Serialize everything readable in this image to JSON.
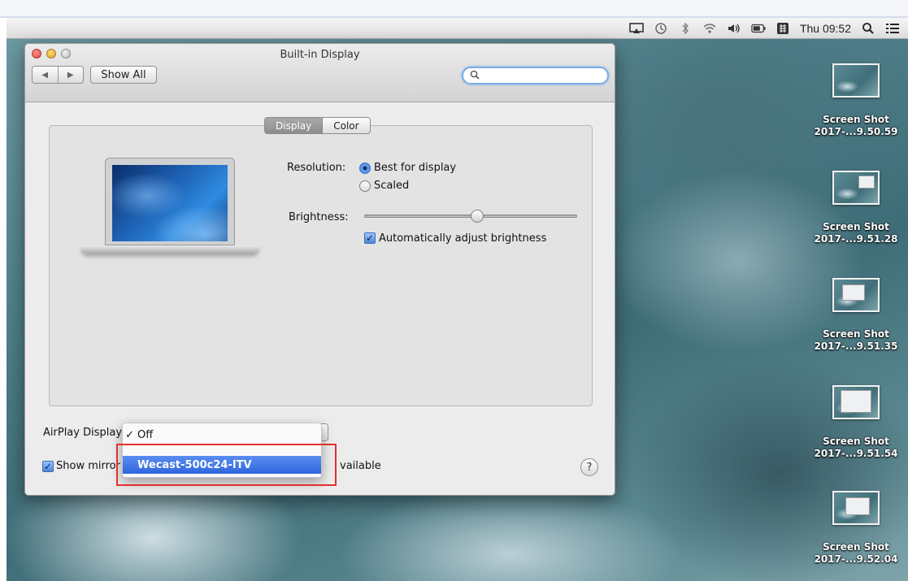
{
  "menubar": {
    "clock": "Thu 09:52",
    "icons": [
      "airplay-icon",
      "time-machine-icon",
      "bluetooth-icon",
      "wifi-icon",
      "volume-icon",
      "battery-icon",
      "input-menu-icon",
      "spotlight-icon",
      "notification-center-icon"
    ]
  },
  "window": {
    "title": "Built-in Display",
    "show_all": "Show All",
    "search_value": "",
    "tabs": [
      {
        "label": "Display",
        "active": true
      },
      {
        "label": "Color",
        "active": false
      }
    ],
    "resolution_label": "Resolution:",
    "resolution_options": [
      {
        "label": "Best for display",
        "selected": true
      },
      {
        "label": "Scaled",
        "selected": false
      }
    ],
    "brightness_label": "Brightness:",
    "brightness_level": 0.53,
    "auto_brightness_label": "Automatically adjust brightness",
    "auto_brightness_checked": true,
    "airplay_label": "AirPlay Display",
    "show_mirroring_label_start": "Show mirror",
    "show_mirroring_label_end": "vailable",
    "help": "?"
  },
  "airplay_menu": {
    "items": [
      {
        "label": "Off",
        "checked": true,
        "highlighted": false
      },
      {
        "label": "Wecast-500c24-ITV",
        "checked": false,
        "highlighted": true
      }
    ],
    "check_glyph": "✓"
  },
  "desktop_icons": [
    {
      "line1": "Screen Shot",
      "line2": "2017-...9.50.59"
    },
    {
      "line1": "Screen Shot",
      "line2": "2017-...9.51.28"
    },
    {
      "line1": "Screen Shot",
      "line2": "2017-...9.51.35"
    },
    {
      "line1": "Screen Shot",
      "line2": "2017-...9.51.54"
    },
    {
      "line1": "Screen Shot",
      "line2": "2017-...9.52.04"
    }
  ],
  "colors": {
    "accent": "#3a72dc",
    "highlight_box": "#e0312f"
  }
}
